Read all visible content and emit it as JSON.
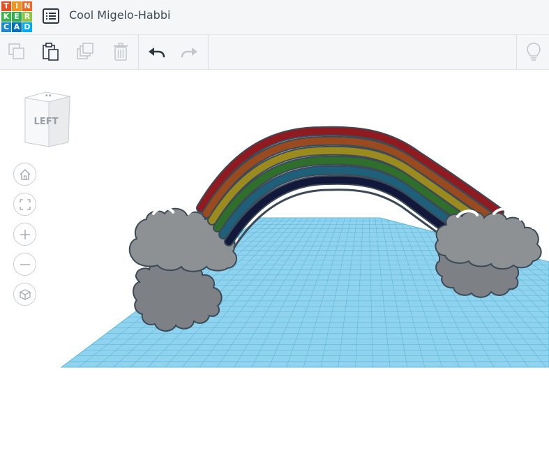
{
  "app": {
    "logo_letters": [
      "T",
      "I",
      "N",
      "K",
      "E",
      "R",
      "C",
      "A",
      "D"
    ],
    "design_title": "Cool Migelo-Habbi"
  },
  "toolbar": {
    "copy_icon": "copy-icon",
    "paste_icon": "paste-icon",
    "duplicate_icon": "duplicate-icon",
    "delete_icon": "trash-icon",
    "undo_icon": "undo-arrow-icon",
    "redo_icon": "redo-arrow-icon",
    "hint_icon": "lightbulb-icon"
  },
  "viewcube": {
    "face_label": "LEFT"
  },
  "nav": {
    "buttons": [
      "home-view",
      "fit-all",
      "zoom-in",
      "zoom-out",
      "ortho-view"
    ]
  },
  "colors": {
    "logo": [
      "#e84e25",
      "#f7941d",
      "#f26522",
      "#39b54a",
      "#2ab24a",
      "#8dc63f",
      "#1e88c7",
      "#0072bc",
      "#00aeef"
    ],
    "grid_fill": "#8fd3ee",
    "grid_line": "#5fb5da",
    "cloud": "#8e9194",
    "rainbow": [
      "#8f1a1f",
      "#9a4a1f",
      "#9b8a1e",
      "#2f6e2b",
      "#1e5f7a",
      "#12183a"
    ]
  }
}
